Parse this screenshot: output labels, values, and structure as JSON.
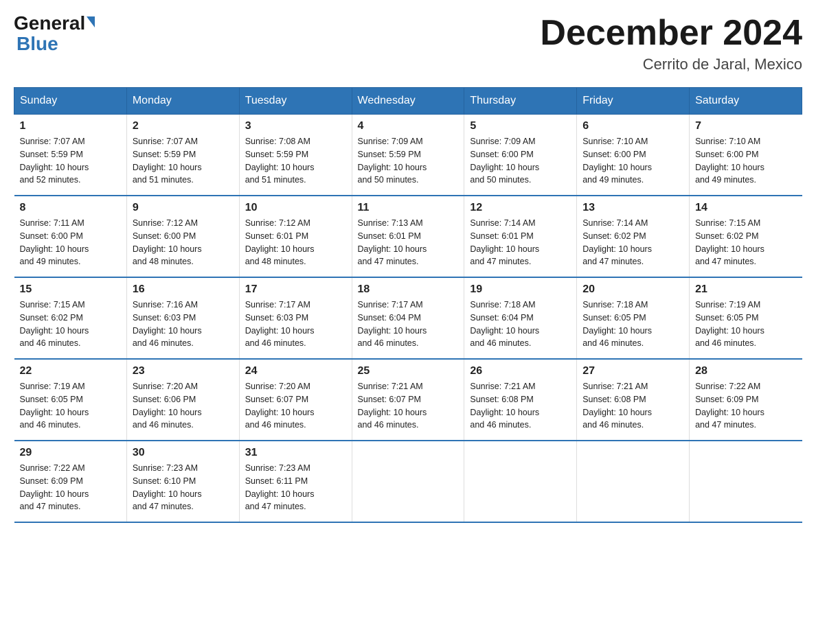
{
  "header": {
    "logo_general": "General",
    "logo_blue": "Blue",
    "title": "December 2024",
    "subtitle": "Cerrito de Jaral, Mexico"
  },
  "days_of_week": [
    "Sunday",
    "Monday",
    "Tuesday",
    "Wednesday",
    "Thursday",
    "Friday",
    "Saturday"
  ],
  "weeks": [
    [
      {
        "day": "1",
        "sunrise": "7:07 AM",
        "sunset": "5:59 PM",
        "daylight": "10 hours and 52 minutes."
      },
      {
        "day": "2",
        "sunrise": "7:07 AM",
        "sunset": "5:59 PM",
        "daylight": "10 hours and 51 minutes."
      },
      {
        "day": "3",
        "sunrise": "7:08 AM",
        "sunset": "5:59 PM",
        "daylight": "10 hours and 51 minutes."
      },
      {
        "day": "4",
        "sunrise": "7:09 AM",
        "sunset": "5:59 PM",
        "daylight": "10 hours and 50 minutes."
      },
      {
        "day": "5",
        "sunrise": "7:09 AM",
        "sunset": "6:00 PM",
        "daylight": "10 hours and 50 minutes."
      },
      {
        "day": "6",
        "sunrise": "7:10 AM",
        "sunset": "6:00 PM",
        "daylight": "10 hours and 49 minutes."
      },
      {
        "day": "7",
        "sunrise": "7:10 AM",
        "sunset": "6:00 PM",
        "daylight": "10 hours and 49 minutes."
      }
    ],
    [
      {
        "day": "8",
        "sunrise": "7:11 AM",
        "sunset": "6:00 PM",
        "daylight": "10 hours and 49 minutes."
      },
      {
        "day": "9",
        "sunrise": "7:12 AM",
        "sunset": "6:00 PM",
        "daylight": "10 hours and 48 minutes."
      },
      {
        "day": "10",
        "sunrise": "7:12 AM",
        "sunset": "6:01 PM",
        "daylight": "10 hours and 48 minutes."
      },
      {
        "day": "11",
        "sunrise": "7:13 AM",
        "sunset": "6:01 PM",
        "daylight": "10 hours and 47 minutes."
      },
      {
        "day": "12",
        "sunrise": "7:14 AM",
        "sunset": "6:01 PM",
        "daylight": "10 hours and 47 minutes."
      },
      {
        "day": "13",
        "sunrise": "7:14 AM",
        "sunset": "6:02 PM",
        "daylight": "10 hours and 47 minutes."
      },
      {
        "day": "14",
        "sunrise": "7:15 AM",
        "sunset": "6:02 PM",
        "daylight": "10 hours and 47 minutes."
      }
    ],
    [
      {
        "day": "15",
        "sunrise": "7:15 AM",
        "sunset": "6:02 PM",
        "daylight": "10 hours and 46 minutes."
      },
      {
        "day": "16",
        "sunrise": "7:16 AM",
        "sunset": "6:03 PM",
        "daylight": "10 hours and 46 minutes."
      },
      {
        "day": "17",
        "sunrise": "7:17 AM",
        "sunset": "6:03 PM",
        "daylight": "10 hours and 46 minutes."
      },
      {
        "day": "18",
        "sunrise": "7:17 AM",
        "sunset": "6:04 PM",
        "daylight": "10 hours and 46 minutes."
      },
      {
        "day": "19",
        "sunrise": "7:18 AM",
        "sunset": "6:04 PM",
        "daylight": "10 hours and 46 minutes."
      },
      {
        "day": "20",
        "sunrise": "7:18 AM",
        "sunset": "6:05 PM",
        "daylight": "10 hours and 46 minutes."
      },
      {
        "day": "21",
        "sunrise": "7:19 AM",
        "sunset": "6:05 PM",
        "daylight": "10 hours and 46 minutes."
      }
    ],
    [
      {
        "day": "22",
        "sunrise": "7:19 AM",
        "sunset": "6:05 PM",
        "daylight": "10 hours and 46 minutes."
      },
      {
        "day": "23",
        "sunrise": "7:20 AM",
        "sunset": "6:06 PM",
        "daylight": "10 hours and 46 minutes."
      },
      {
        "day": "24",
        "sunrise": "7:20 AM",
        "sunset": "6:07 PM",
        "daylight": "10 hours and 46 minutes."
      },
      {
        "day": "25",
        "sunrise": "7:21 AM",
        "sunset": "6:07 PM",
        "daylight": "10 hours and 46 minutes."
      },
      {
        "day": "26",
        "sunrise": "7:21 AM",
        "sunset": "6:08 PM",
        "daylight": "10 hours and 46 minutes."
      },
      {
        "day": "27",
        "sunrise": "7:21 AM",
        "sunset": "6:08 PM",
        "daylight": "10 hours and 46 minutes."
      },
      {
        "day": "28",
        "sunrise": "7:22 AM",
        "sunset": "6:09 PM",
        "daylight": "10 hours and 47 minutes."
      }
    ],
    [
      {
        "day": "29",
        "sunrise": "7:22 AM",
        "sunset": "6:09 PM",
        "daylight": "10 hours and 47 minutes."
      },
      {
        "day": "30",
        "sunrise": "7:23 AM",
        "sunset": "6:10 PM",
        "daylight": "10 hours and 47 minutes."
      },
      {
        "day": "31",
        "sunrise": "7:23 AM",
        "sunset": "6:11 PM",
        "daylight": "10 hours and 47 minutes."
      },
      null,
      null,
      null,
      null
    ]
  ],
  "labels": {
    "sunrise": "Sunrise:",
    "sunset": "Sunset:",
    "daylight": "Daylight:"
  }
}
